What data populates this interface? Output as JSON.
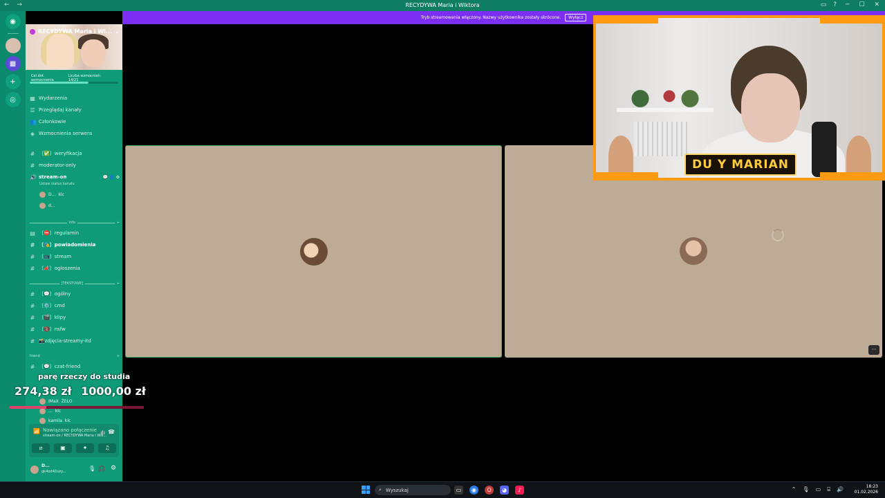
{
  "window": {
    "title": "RECYDYWA Maria i Wiktora"
  },
  "stream_banner": {
    "text": "Tryb streamowania włączony. Nazwy użytkownika zostały skrócone.",
    "button": "Wyłącz"
  },
  "server": {
    "name": "RECYDYWA Maria i Wi...",
    "boost_goal_label": "Cel dot. wzmocnienia",
    "boost_count_label": "Liczba wzmocnień: 14/21",
    "boost_progress": 0.6667
  },
  "sidebar_menu": [
    {
      "icon": "calendar-icon",
      "label": "Wydarzenia"
    },
    {
      "icon": "list-icon",
      "label": "Przeglądaj kanały"
    },
    {
      "icon": "members-icon",
      "label": "Członkowie"
    },
    {
      "icon": "boost-icon",
      "label": "Wzmocnienia serwera"
    }
  ],
  "channels_top": [
    {
      "label": "〔✅〕weryfikacja"
    },
    {
      "label": "moderator-only"
    }
  ],
  "voice_channel": {
    "label": "stream-on",
    "status_hint": "Ustaw status kanału",
    "users": [
      {
        "name": "D...",
        "extra": "klc"
      },
      {
        "name": "d..."
      }
    ]
  },
  "categories": {
    "info": "info",
    "tekstowe": "[TEKSTOWE]",
    "friend": "friend"
  },
  "channels_info": [
    {
      "label": "〔⛔〕regulamin",
      "bold": false
    },
    {
      "label": "〔🎭〕powiadomienia",
      "bold": true
    },
    {
      "label": "〔📺〕stream",
      "bold": false
    },
    {
      "label": "〔📣〕ogloszenia",
      "bold": false
    }
  ],
  "channels_text": [
    {
      "label": "〔💬〕ogólny"
    },
    {
      "label": "〔⚙️〕cmd"
    },
    {
      "label": "〔🎬〕klipy"
    },
    {
      "label": "〔🔞〕nsfw"
    },
    {
      "label": "📸zdjęcia-streamy-itd"
    }
  ],
  "channels_friend": [
    {
      "label": "〔💬〕czat-friend"
    }
  ],
  "friend_voice_users": [
    {
      "name": "IMaX",
      "extra": "ŻELO"
    },
    {
      "name": "...",
      "extra": "klc"
    },
    {
      "name": "kamila",
      "extra": "klc"
    }
  ],
  "donation_overlay": {
    "goal": "parę rzeczy do studia",
    "current": "274,38 zł",
    "target": "1000,00 zł",
    "progress": 0.2744
  },
  "voice_panel": {
    "status": "Nawiązano połączenie",
    "path": "stream-on / RECYDYWA Maria i Wik..."
  },
  "user_panel": {
    "name": "D...",
    "status": "gk4od4Duzy..."
  },
  "webcam": {
    "nameplate": "DU  Y MARIAN"
  },
  "taskbar": {
    "search_placeholder": "Wyszukaj",
    "time": "18:23",
    "date": "01.02.2026"
  }
}
